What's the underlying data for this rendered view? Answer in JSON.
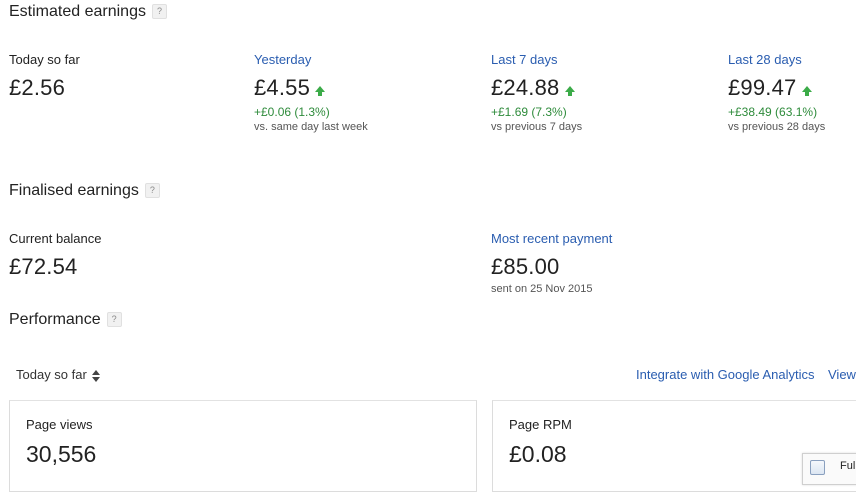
{
  "estimated": {
    "title": "Estimated earnings",
    "help": "?",
    "items": [
      {
        "label": "Today so far",
        "value": "£2.56",
        "delta": "",
        "note": ""
      },
      {
        "label": "Yesterday",
        "value": "£4.55",
        "delta": "+£0.06 (1.3%)",
        "note": "vs. same day last week"
      },
      {
        "label": "Last 7 days",
        "value": "£24.88",
        "delta": "+£1.69 (7.3%)",
        "note": "vs previous 7 days"
      },
      {
        "label": "Last 28 days",
        "value": "£99.47",
        "delta": "+£38.49 (63.1%)",
        "note": "vs previous 28 days"
      }
    ]
  },
  "finalised": {
    "title": "Finalised earnings",
    "help": "?",
    "balance_label": "Current balance",
    "balance_value": "£72.54",
    "payment_label": "Most recent payment",
    "payment_value": "£85.00",
    "payment_note": "sent on 25 Nov 2015"
  },
  "performance": {
    "title": "Performance",
    "help": "?",
    "range": "Today so far",
    "integrate_link": "Integrate with Google Analytics",
    "view_link": "View",
    "cards": [
      {
        "label": "Page views",
        "value": "30,556"
      },
      {
        "label": "Page RPM",
        "value": "£0.08"
      }
    ]
  },
  "toast": {
    "text": "Ful"
  },
  "colors": {
    "link": "#2a5db0",
    "positive": "#2e8b3b",
    "arrow": "#3bab48"
  }
}
